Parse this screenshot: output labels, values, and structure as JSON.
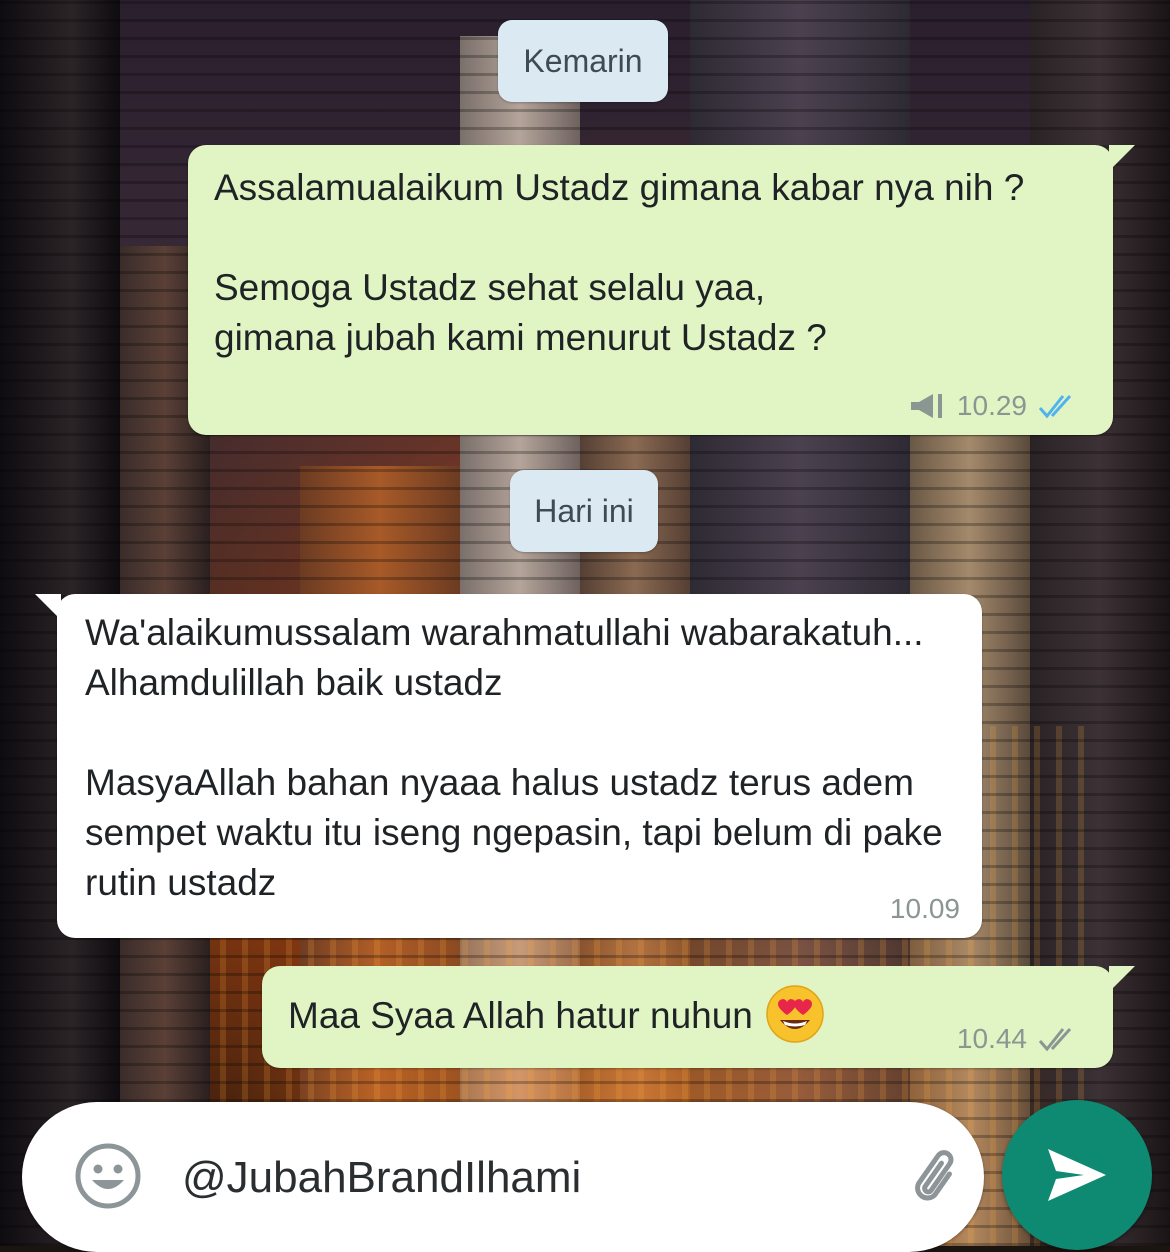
{
  "dates": {
    "yesterday": "Kemarin",
    "today": "Hari ini"
  },
  "messages": [
    {
      "direction": "outgoing",
      "paragraphs": [
        "Assalamualaikum Ustadz gimana kabar nya nih ?",
        "Semoga Ustadz sehat selalu yaa, gimana jubah kami menurut Ustadz ?"
      ],
      "time": "10.29",
      "status": "read",
      "broadcast_icon": "megaphone-icon"
    },
    {
      "direction": "incoming",
      "paragraphs": [
        "Wa'alaikumussalam warahmatullahi wabarakatuh... Alhamdulillah baik ustadz",
        "MasyaAllah bahan nyaaa halus ustadz terus adem sempet waktu itu iseng ngepasin, tapi belum di pake rutin ustadz"
      ],
      "time": "10.09"
    },
    {
      "direction": "outgoing",
      "text": "Maa Syaa Allah hatur nuhun",
      "emoji": "heart-eyes-emoji",
      "time": "10.44",
      "status": "delivered"
    }
  ],
  "composer": {
    "value": "@JubahBrandIlhami",
    "emoji_icon": "smiley-icon",
    "attach_icon": "paperclip-icon",
    "send_icon": "send-icon"
  },
  "colors": {
    "outgoing_bubble": "#e1f5c4",
    "incoming_bubble": "#ffffff",
    "date_chip": "#dbe9f2",
    "read_ticks": "#4fb3f0",
    "send_button": "#0e8a72"
  }
}
